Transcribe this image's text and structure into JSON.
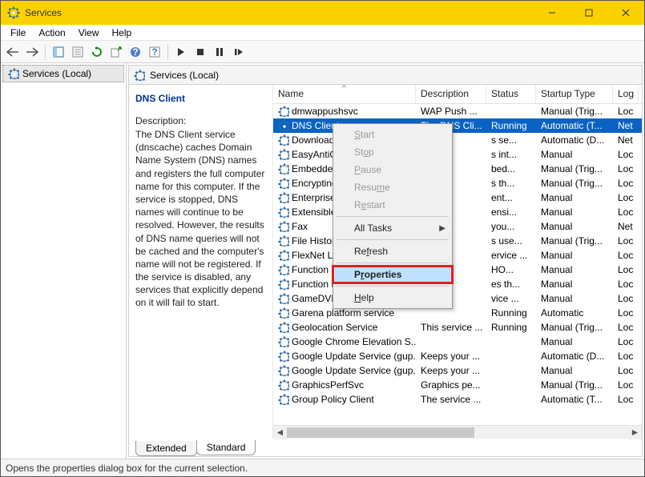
{
  "window": {
    "title": "Services"
  },
  "menubar": [
    "File",
    "Action",
    "View",
    "Help"
  ],
  "left_tree": {
    "root": "Services (Local)"
  },
  "right_header": "Services (Local)",
  "detail": {
    "service_title": "DNS Client",
    "desc_label": "Description:",
    "desc_text": "The DNS Client service (dnscache) caches Domain Name System (DNS) names and registers the full computer name for this computer. If the service is stopped, DNS names will continue to be resolved. However, the results of DNS name queries will not be cached and the computer's name will not be registered. If the service is disabled, any services that explicitly depend on it will fail to start."
  },
  "columns": {
    "name": "Name",
    "description": "Description",
    "status": "Status",
    "startup": "Startup Type",
    "logon": "Log"
  },
  "services": [
    {
      "name": "dmwappushsvc",
      "desc": "WAP Push ...",
      "status": "",
      "startup": "Manual (Trig...",
      "logon": "Loc"
    },
    {
      "name": "DNS Client",
      "desc": "The DNS Cli...",
      "status": "Running",
      "startup": "Automatic (T...",
      "logon": "Net",
      "selected": true
    },
    {
      "name": "Downloade",
      "desc": "",
      "status": "s se...",
      "startup": "Automatic (D...",
      "logon": "Net"
    },
    {
      "name": "EasyAntiCh",
      "desc": "",
      "status": "s int...",
      "startup": "Manual",
      "logon": "Loc"
    },
    {
      "name": "Embedded",
      "desc": "",
      "status": "bed...",
      "startup": "Manual (Trig...",
      "logon": "Loc"
    },
    {
      "name": "Encrypting",
      "desc": "",
      "status": "s th...",
      "startup": "Manual (Trig...",
      "logon": "Loc"
    },
    {
      "name": "Enterprise ",
      "desc": "",
      "status": "ent...",
      "startup": "Manual",
      "logon": "Loc"
    },
    {
      "name": "Extensible ",
      "desc": "",
      "status": "ensi...",
      "startup": "Manual",
      "logon": "Loc"
    },
    {
      "name": "Fax",
      "desc": "",
      "status": "you...",
      "startup": "Manual",
      "logon": "Net"
    },
    {
      "name": "File History",
      "desc": "",
      "status": "s use...",
      "startup": "Manual (Trig...",
      "logon": "Loc"
    },
    {
      "name": "FlexNet Lic",
      "desc": "",
      "status": "ervice ...",
      "startup": "Manual",
      "logon": "Loc"
    },
    {
      "name": "Function B",
      "desc": "",
      "status": "HO...",
      "startup": "Manual",
      "logon": "Loc"
    },
    {
      "name": "Function B",
      "desc": "",
      "status": "es th...",
      "startup": "Manual",
      "logon": "Loc"
    },
    {
      "name": "GameDVR ",
      "desc": "",
      "status": "vice ...",
      "startup": "Manual",
      "logon": "Loc"
    },
    {
      "name": "Garena platform service",
      "desc": "",
      "status": "Running",
      "startup": "Automatic",
      "logon": "Loc"
    },
    {
      "name": "Geolocation Service",
      "desc": "This service ...",
      "status": "Running",
      "startup": "Manual (Trig...",
      "logon": "Loc"
    },
    {
      "name": "Google Chrome Elevation S...",
      "desc": "",
      "status": "",
      "startup": "Manual",
      "logon": "Loc"
    },
    {
      "name": "Google Update Service (gup...",
      "desc": "Keeps your ...",
      "status": "",
      "startup": "Automatic (D...",
      "logon": "Loc"
    },
    {
      "name": "Google Update Service (gup...",
      "desc": "Keeps your ...",
      "status": "",
      "startup": "Manual",
      "logon": "Loc"
    },
    {
      "name": "GraphicsPerfSvc",
      "desc": "Graphics pe...",
      "status": "",
      "startup": "Manual (Trig...",
      "logon": "Loc"
    },
    {
      "name": "Group Policy Client",
      "desc": "The service ...",
      "status": "",
      "startup": "Automatic (T...",
      "logon": "Loc"
    }
  ],
  "context_menu": {
    "start": "Start",
    "stop": "Stop",
    "pause": "Pause",
    "resume": "Resume",
    "restart": "Restart",
    "all_tasks": "All Tasks",
    "refresh": "Refresh",
    "properties": "Properties",
    "help": "Help"
  },
  "tabs": {
    "extended": "Extended",
    "standard": "Standard"
  },
  "statusbar": "Opens the properties dialog box for the current selection."
}
